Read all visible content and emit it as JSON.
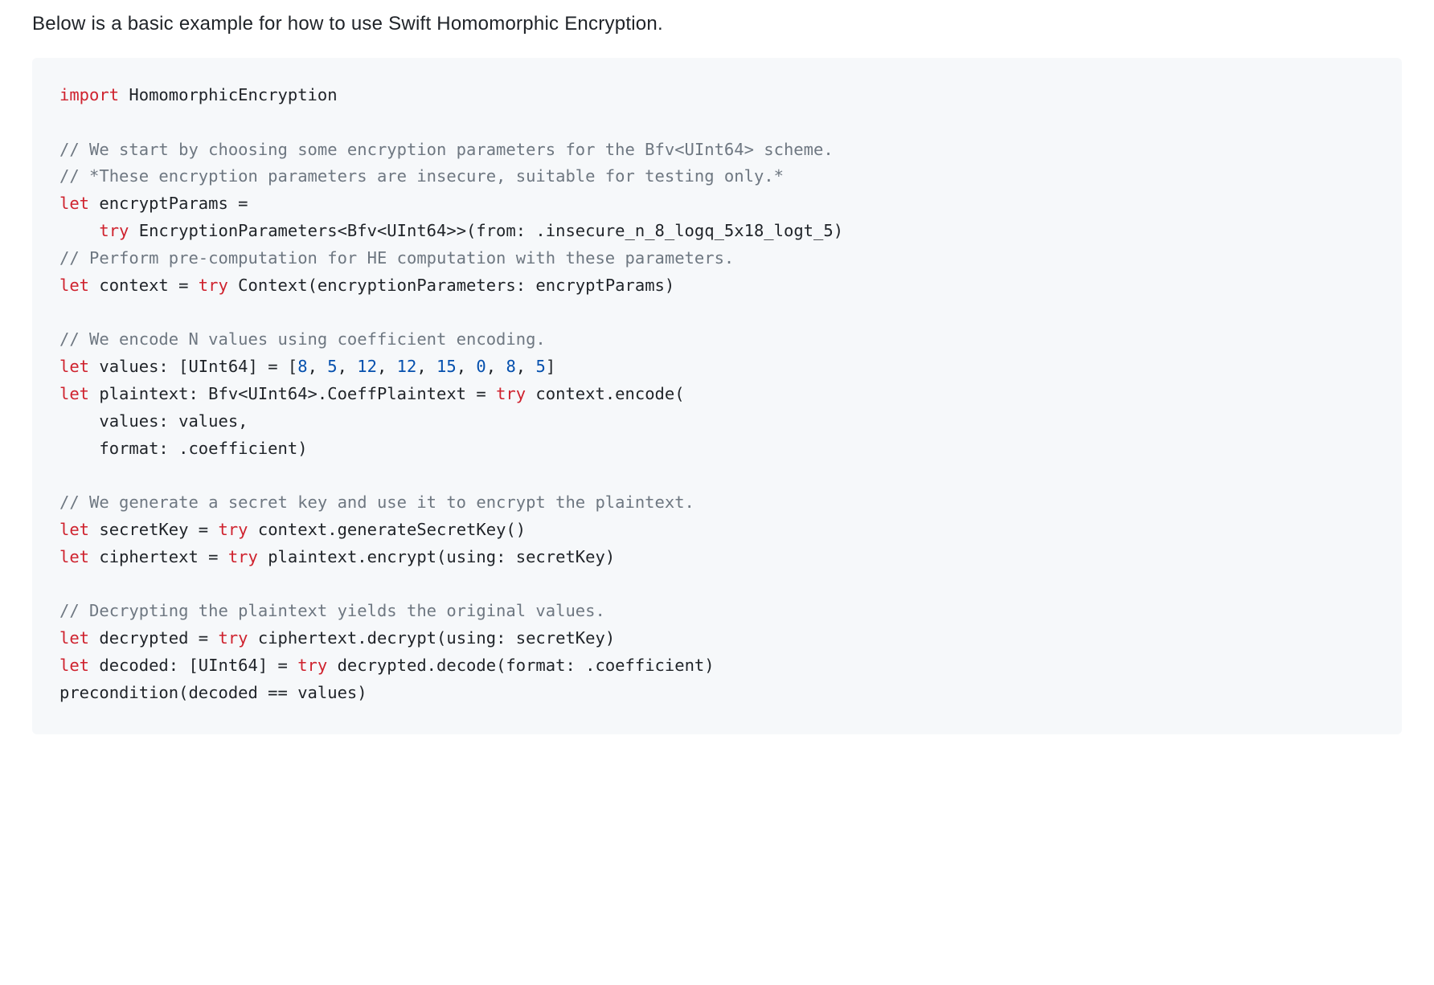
{
  "intro": "Below is a basic example for how to use Swift Homomorphic Encryption.",
  "code": {
    "lines": [
      [
        {
          "c": "kw",
          "t": "import"
        },
        {
          "c": "txt",
          "t": " HomomorphicEncryption"
        }
      ],
      [],
      [
        {
          "c": "cmt",
          "t": "// We start by choosing some encryption parameters for the Bfv<UInt64> scheme."
        }
      ],
      [
        {
          "c": "cmt",
          "t": "// *These encryption parameters are insecure, suitable for testing only.*"
        }
      ],
      [
        {
          "c": "kw",
          "t": "let"
        },
        {
          "c": "txt",
          "t": " encryptParams ="
        }
      ],
      [
        {
          "c": "txt",
          "t": "    "
        },
        {
          "c": "kw",
          "t": "try"
        },
        {
          "c": "txt",
          "t": " EncryptionParameters<Bfv<UInt64>>(from: .insecure_n_8_logq_5x18_logt_5)"
        }
      ],
      [
        {
          "c": "cmt",
          "t": "// Perform pre-computation for HE computation with these parameters."
        }
      ],
      [
        {
          "c": "kw",
          "t": "let"
        },
        {
          "c": "txt",
          "t": " context = "
        },
        {
          "c": "kw",
          "t": "try"
        },
        {
          "c": "txt",
          "t": " Context(encryptionParameters: encryptParams)"
        }
      ],
      [],
      [
        {
          "c": "cmt",
          "t": "// We encode N values using coefficient encoding."
        }
      ],
      [
        {
          "c": "kw",
          "t": "let"
        },
        {
          "c": "txt",
          "t": " values: [UInt64] = ["
        },
        {
          "c": "num",
          "t": "8"
        },
        {
          "c": "txt",
          "t": ", "
        },
        {
          "c": "num",
          "t": "5"
        },
        {
          "c": "txt",
          "t": ", "
        },
        {
          "c": "num",
          "t": "12"
        },
        {
          "c": "txt",
          "t": ", "
        },
        {
          "c": "num",
          "t": "12"
        },
        {
          "c": "txt",
          "t": ", "
        },
        {
          "c": "num",
          "t": "15"
        },
        {
          "c": "txt",
          "t": ", "
        },
        {
          "c": "num",
          "t": "0"
        },
        {
          "c": "txt",
          "t": ", "
        },
        {
          "c": "num",
          "t": "8"
        },
        {
          "c": "txt",
          "t": ", "
        },
        {
          "c": "num",
          "t": "5"
        },
        {
          "c": "txt",
          "t": "]"
        }
      ],
      [
        {
          "c": "kw",
          "t": "let"
        },
        {
          "c": "txt",
          "t": " plaintext: Bfv<UInt64>.CoeffPlaintext = "
        },
        {
          "c": "kw",
          "t": "try"
        },
        {
          "c": "txt",
          "t": " context.encode("
        }
      ],
      [
        {
          "c": "txt",
          "t": "    values: values,"
        }
      ],
      [
        {
          "c": "txt",
          "t": "    format: .coefficient)"
        }
      ],
      [],
      [
        {
          "c": "cmt",
          "t": "// We generate a secret key and use it to encrypt the plaintext."
        }
      ],
      [
        {
          "c": "kw",
          "t": "let"
        },
        {
          "c": "txt",
          "t": " secretKey = "
        },
        {
          "c": "kw",
          "t": "try"
        },
        {
          "c": "txt",
          "t": " context.generateSecretKey()"
        }
      ],
      [
        {
          "c": "kw",
          "t": "let"
        },
        {
          "c": "txt",
          "t": " ciphertext = "
        },
        {
          "c": "kw",
          "t": "try"
        },
        {
          "c": "txt",
          "t": " plaintext.encrypt(using: secretKey)"
        }
      ],
      [],
      [
        {
          "c": "cmt",
          "t": "// Decrypting the plaintext yields the original values."
        }
      ],
      [
        {
          "c": "kw",
          "t": "let"
        },
        {
          "c": "txt",
          "t": " decrypted = "
        },
        {
          "c": "kw",
          "t": "try"
        },
        {
          "c": "txt",
          "t": " ciphertext.decrypt(using: secretKey)"
        }
      ],
      [
        {
          "c": "kw",
          "t": "let"
        },
        {
          "c": "txt",
          "t": " decoded: [UInt64] = "
        },
        {
          "c": "kw",
          "t": "try"
        },
        {
          "c": "txt",
          "t": " decrypted.decode(format: .coefficient)"
        }
      ],
      [
        {
          "c": "txt",
          "t": "precondition(decoded == values)"
        }
      ]
    ]
  }
}
